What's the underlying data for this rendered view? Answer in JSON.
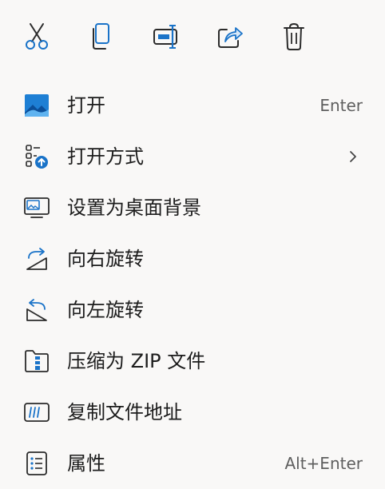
{
  "toolbar": {
    "buttons": [
      {
        "name": "cut",
        "icon": "scissors-icon"
      },
      {
        "name": "copy",
        "icon": "copy-icon"
      },
      {
        "name": "rename",
        "icon": "rename-icon"
      },
      {
        "name": "share",
        "icon": "share-icon"
      },
      {
        "name": "delete",
        "icon": "trash-icon"
      }
    ]
  },
  "menu": {
    "items": [
      {
        "label": "打开",
        "shortcut": "Enter",
        "icon": "image-icon"
      },
      {
        "label": "打开方式",
        "icon": "open-with-icon",
        "has_submenu": true
      },
      {
        "label": "设置为桌面背景",
        "icon": "desktop-background-icon"
      },
      {
        "label": "向右旋转",
        "icon": "rotate-right-icon"
      },
      {
        "label": "向左旋转",
        "icon": "rotate-left-icon"
      },
      {
        "label": "压缩为 ZIP 文件",
        "icon": "zip-folder-icon"
      },
      {
        "label": "复制文件地址",
        "icon": "copy-path-icon"
      },
      {
        "label": "属性",
        "shortcut": "Alt+Enter",
        "icon": "properties-icon"
      }
    ]
  },
  "colors": {
    "accent": "#1a73c8",
    "icon_stroke": "#2b2b2b",
    "background": "#f9f8f7"
  }
}
